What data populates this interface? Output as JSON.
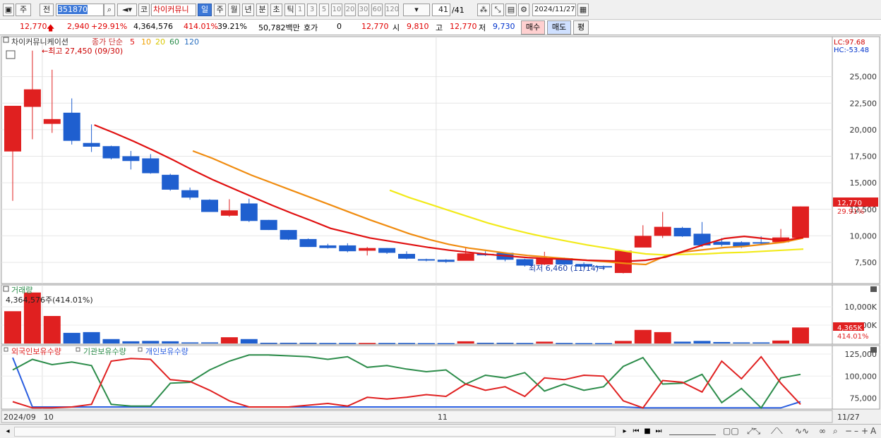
{
  "toolbar": {
    "period_type": "주",
    "prev_label": "전",
    "code": "351870",
    "kor_label": "코",
    "name": "차이커뮤니",
    "periods": [
      "일",
      "주",
      "월",
      "년",
      "분",
      "초",
      "틱"
    ],
    "active_period": "일",
    "intervals": [
      "1",
      "3",
      "5",
      "10",
      "20",
      "30",
      "60",
      "120"
    ],
    "count": "41",
    "count_total": "/41",
    "date": "2024/11/27"
  },
  "quote": {
    "price": "12,770",
    "change": "2,940",
    "change_pct": "+29.91%",
    "volume": "4,364,576",
    "volume_ratio": "414.01%",
    "turnover": "39.21%",
    "amount": "50,782백만",
    "hoga_label": "호가",
    "hoga_value": "0",
    "hoga_price": "12,770",
    "open_label": "시",
    "open": "9,810",
    "high_label": "고",
    "high": "12,770",
    "low_label": "저",
    "low": "9,730",
    "buy_label": "매수",
    "sell_label": "매도",
    "eval_label": "평"
  },
  "price_panel": {
    "stock_name": "차이커뮤니케이션",
    "ma_title": "종가 단순",
    "ma_labels": [
      "5",
      "10",
      "20",
      "60",
      "120"
    ],
    "lc": "LC:97.68",
    "hc": "HC:-53.48",
    "high_note": "←최고 27,450 (09/30)",
    "low_note": "최저 6,460 (11/14)→",
    "last_price_badge": "12,770",
    "last_pct_badge": "29.91%"
  },
  "volume_panel": {
    "title": "거래량",
    "summary": "4,364,576주(414.01%)",
    "badge_value": "4,365K",
    "badge_pct": "414.01%"
  },
  "holdings_panel": {
    "labels": [
      "외국인보유수량",
      "기관보유수량",
      "개인보유수량"
    ]
  },
  "axis": {
    "start_label": "2024/09",
    "month_10": "10",
    "month_11": "11",
    "end_label": "11/27"
  },
  "colors": {
    "up": "#e02020",
    "down": "#1f5fcf",
    "ma5": "#e01010",
    "ma10": "#f08c10",
    "ma20": "#f2ea1a",
    "foreign": "#e02020",
    "institution": "#2c8c4a",
    "individual": "#2a5ee0"
  },
  "chart_data": {
    "type": "candlestick",
    "price_yticks": [
      7500,
      10000,
      12500,
      15000,
      17500,
      20000,
      22500,
      25000
    ],
    "price_ylim": [
      5300,
      28500
    ],
    "vol_yticks": [
      10000,
      5000
    ],
    "vol_ylim": [
      0,
      14000
    ],
    "vol_unit": "K",
    "holdings_yticks": [
      125000,
      100000,
      75000
    ],
    "holdings_ylim": [
      60000,
      130000
    ],
    "candles": [
      {
        "o": 17950,
        "h": 22050,
        "l": 13300,
        "c": 22250,
        "v": 8800
      },
      {
        "o": 22150,
        "h": 27450,
        "l": 19100,
        "c": 23800,
        "v": 13900
      },
      {
        "o": 20550,
        "h": 25650,
        "l": 19700,
        "c": 21000,
        "v": 7500
      },
      {
        "o": 21600,
        "h": 22950,
        "l": 18600,
        "c": 18950,
        "v": 2900
      },
      {
        "o": 18750,
        "h": 20500,
        "l": 17900,
        "c": 18400,
        "v": 3100
      },
      {
        "o": 18450,
        "h": 18500,
        "l": 17200,
        "c": 17300,
        "v": 1200
      },
      {
        "o": 17500,
        "h": 18000,
        "l": 16250,
        "c": 17050,
        "v": 600
      },
      {
        "o": 17300,
        "h": 17700,
        "l": 15850,
        "c": 15900,
        "v": 700
      },
      {
        "o": 15750,
        "h": 15850,
        "l": 14250,
        "c": 14350,
        "v": 600
      },
      {
        "o": 14300,
        "h": 14550,
        "l": 13400,
        "c": 13600,
        "v": 300
      },
      {
        "o": 13400,
        "h": 13450,
        "l": 12250,
        "c": 12250,
        "v": 300
      },
      {
        "o": 11900,
        "h": 13450,
        "l": 11800,
        "c": 12400,
        "v": 1700
      },
      {
        "o": 13050,
        "h": 13500,
        "l": 11300,
        "c": 11400,
        "v": 1200
      },
      {
        "o": 11500,
        "h": 11500,
        "l": 10550,
        "c": 10550,
        "v": 200
      },
      {
        "o": 10550,
        "h": 10550,
        "l": 9600,
        "c": 9650,
        "v": 200
      },
      {
        "o": 9700,
        "h": 9750,
        "l": 8950,
        "c": 8950,
        "v": 200
      },
      {
        "o": 9100,
        "h": 9250,
        "l": 8800,
        "c": 8850,
        "v": 150
      },
      {
        "o": 9100,
        "h": 9300,
        "l": 8450,
        "c": 8550,
        "v": 150
      },
      {
        "o": 8600,
        "h": 8950,
        "l": 8150,
        "c": 8850,
        "v": 150
      },
      {
        "o": 8850,
        "h": 8850,
        "l": 8300,
        "c": 8400,
        "v": 150
      },
      {
        "o": 8300,
        "h": 8550,
        "l": 7800,
        "c": 7850,
        "v": 150
      },
      {
        "o": 7800,
        "h": 7850,
        "l": 7600,
        "c": 7700,
        "v": 100
      },
      {
        "o": 7750,
        "h": 7800,
        "l": 7450,
        "c": 7550,
        "v": 100
      },
      {
        "o": 7650,
        "h": 8900,
        "l": 7700,
        "c": 8350,
        "v": 600
      },
      {
        "o": 8300,
        "h": 8550,
        "l": 8100,
        "c": 8200,
        "v": 200
      },
      {
        "o": 8400,
        "h": 8450,
        "l": 7600,
        "c": 7750,
        "v": 200
      },
      {
        "o": 7800,
        "h": 7850,
        "l": 7100,
        "c": 7200,
        "v": 150
      },
      {
        "o": 7300,
        "h": 8500,
        "l": 7250,
        "c": 7900,
        "v": 500
      },
      {
        "o": 7900,
        "h": 7950,
        "l": 7250,
        "c": 7300,
        "v": 150
      },
      {
        "o": 7350,
        "h": 7500,
        "l": 6950,
        "c": 7100,
        "v": 100
      },
      {
        "o": 7150,
        "h": 7200,
        "l": 6950,
        "c": 7050,
        "v": 100
      },
      {
        "o": 6500,
        "h": 8600,
        "l": 6460,
        "c": 8600,
        "v": 700
      },
      {
        "o": 8900,
        "h": 11000,
        "l": 8950,
        "c": 10000,
        "v": 3700
      },
      {
        "o": 10000,
        "h": 12250,
        "l": 9800,
        "c": 10850,
        "v": 3100
      },
      {
        "o": 10750,
        "h": 10850,
        "l": 9900,
        "c": 9950,
        "v": 500
      },
      {
        "o": 10200,
        "h": 11300,
        "l": 8950,
        "c": 9100,
        "v": 700
      },
      {
        "o": 9450,
        "h": 9800,
        "l": 9000,
        "c": 9150,
        "v": 400
      },
      {
        "o": 9400,
        "h": 9500,
        "l": 8850,
        "c": 9000,
        "v": 300
      },
      {
        "o": 9400,
        "h": 9950,
        "l": 9100,
        "c": 9350,
        "v": 300
      },
      {
        "o": 9400,
        "h": 10650,
        "l": 9300,
        "c": 9850,
        "v": 800
      },
      {
        "o": 9810,
        "h": 12770,
        "l": 9730,
        "c": 12770,
        "v": 4365
      }
    ],
    "ma5": [
      null,
      null,
      null,
      null,
      20450,
      19700,
      18900,
      18050,
      17150,
      16200,
      15300,
      14500,
      13700,
      12900,
      12150,
      11450,
      10700,
      10250,
      9800,
      9500,
      9200,
      8900,
      8650,
      8450,
      8250,
      8100,
      7950,
      7850,
      7800,
      7700,
      7650,
      7600,
      7700,
      8000,
      8600,
      9200,
      9750,
      9950,
      9750,
      9550,
      9850
    ],
    "ma10": [
      null,
      null,
      null,
      null,
      null,
      null,
      null,
      null,
      null,
      18000,
      17300,
      16500,
      15700,
      15000,
      14300,
      13600,
      12900,
      12200,
      11500,
      10850,
      10200,
      9650,
      9200,
      8850,
      8600,
      8350,
      8150,
      8000,
      7850,
      7700,
      7550,
      7400,
      7300,
      8100,
      8500,
      8700,
      8900,
      9000,
      9200,
      9400,
      9800
    ],
    "ma20": [
      null,
      null,
      null,
      null,
      null,
      null,
      null,
      null,
      null,
      null,
      null,
      null,
      null,
      null,
      null,
      null,
      null,
      null,
      null,
      14300,
      13600,
      13000,
      12400,
      11800,
      11200,
      10700,
      10250,
      9850,
      9500,
      9150,
      8850,
      8550,
      8300,
      8200,
      8250,
      8300,
      8400,
      8450,
      8550,
      8650,
      8750
    ],
    "foreign": [
      71000,
      64000,
      64000,
      65000,
      68000,
      117000,
      120000,
      119000,
      96000,
      94000,
      84000,
      72000,
      65000,
      65000,
      65000,
      67000,
      69000,
      66000,
      76000,
      74000,
      76000,
      79000,
      77000,
      91000,
      84000,
      88000,
      77000,
      98000,
      96000,
      101000,
      100000,
      72000,
      64000,
      95000,
      93000,
      82000,
      117000,
      97000,
      122000,
      92000,
      68000
    ],
    "institution": [
      107000,
      119000,
      113000,
      116000,
      112000,
      68000,
      66000,
      66000,
      92000,
      93000,
      107000,
      117000,
      124000,
      124000,
      123000,
      122000,
      119000,
      122000,
      110000,
      112000,
      108000,
      105000,
      107000,
      91000,
      101000,
      98000,
      104000,
      83000,
      91000,
      84000,
      88000,
      111000,
      121000,
      91000,
      92000,
      102000,
      70000,
      86000,
      64000,
      98000,
      102000
    ],
    "individual": [
      121000,
      65000,
      65000,
      65000,
      65000,
      65000,
      65000,
      65000,
      65000,
      65000,
      65000,
      65000,
      65000,
      65000,
      65000,
      65000,
      65000,
      65000,
      65000,
      65000,
      65000,
      65000,
      65000,
      65000,
      65000,
      65000,
      65000,
      65000,
      65000,
      65000,
      65000,
      65000,
      64000,
      64000,
      64000,
      64000,
      64000,
      64000,
      64000,
      64000,
      71000
    ]
  }
}
